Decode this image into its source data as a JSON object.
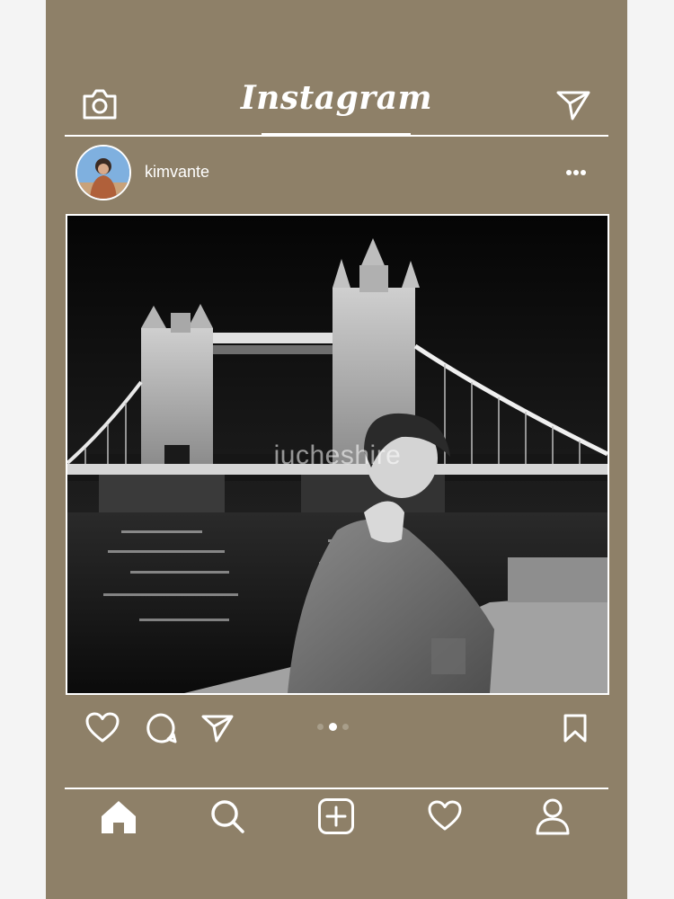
{
  "header": {
    "title": "Instagram",
    "camera_icon": "camera-icon",
    "direct_icon": "paper-plane-icon"
  },
  "post": {
    "username": "kimvante",
    "more_icon": "more-dots-icon",
    "watermark": "iucheshire",
    "carousel": {
      "count": 3,
      "active_index": 1
    }
  },
  "actions": {
    "like_icon": "heart-icon",
    "comment_icon": "comment-icon",
    "share_icon": "paper-plane-icon",
    "save_icon": "bookmark-icon"
  },
  "bottom_nav": {
    "items": [
      "home-icon",
      "search-icon",
      "add-post-icon",
      "activity-heart-icon",
      "profile-icon"
    ]
  },
  "colors": {
    "background": "#8e8068",
    "foreground": "#ffffff"
  }
}
